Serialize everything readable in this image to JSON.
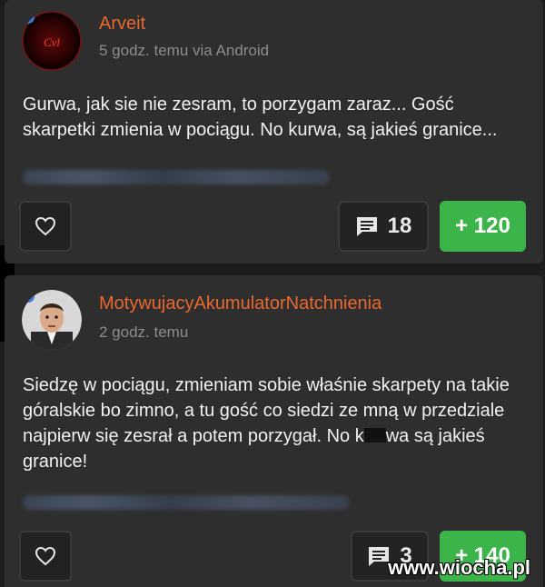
{
  "posts": [
    {
      "username": "Arveit",
      "meta": "5 godz. temu via Android",
      "body": "Gurwa, jak sie nie zesram, to porzygam zaraz... Gość skarpetki zmienia w pociągu. No kurwa, są jakieś granice...",
      "comments_count": "18",
      "votes": "+ 120"
    },
    {
      "username": "MotywujacyAkumulatorNatchnienia",
      "meta": "2 godz. temu",
      "body_before": "Siedzę w pociągu, zmieniam sobie właśnie skarpety na takie góralskie bo zimno, a tu gość co siedzi ze mną w przedziale najpierw się zesrał a potem porzygał. No k",
      "body_after": "wa są jakieś granice!",
      "comments_count": "3",
      "votes": "+ 140"
    }
  ],
  "watermark": "www.wiocha.pl",
  "colors": {
    "username": "#e9682e",
    "vote_green": "#3bb54a",
    "online_dot": "#3b78d8"
  },
  "icons": {
    "like": "heart-icon",
    "comments": "comment-icon"
  }
}
